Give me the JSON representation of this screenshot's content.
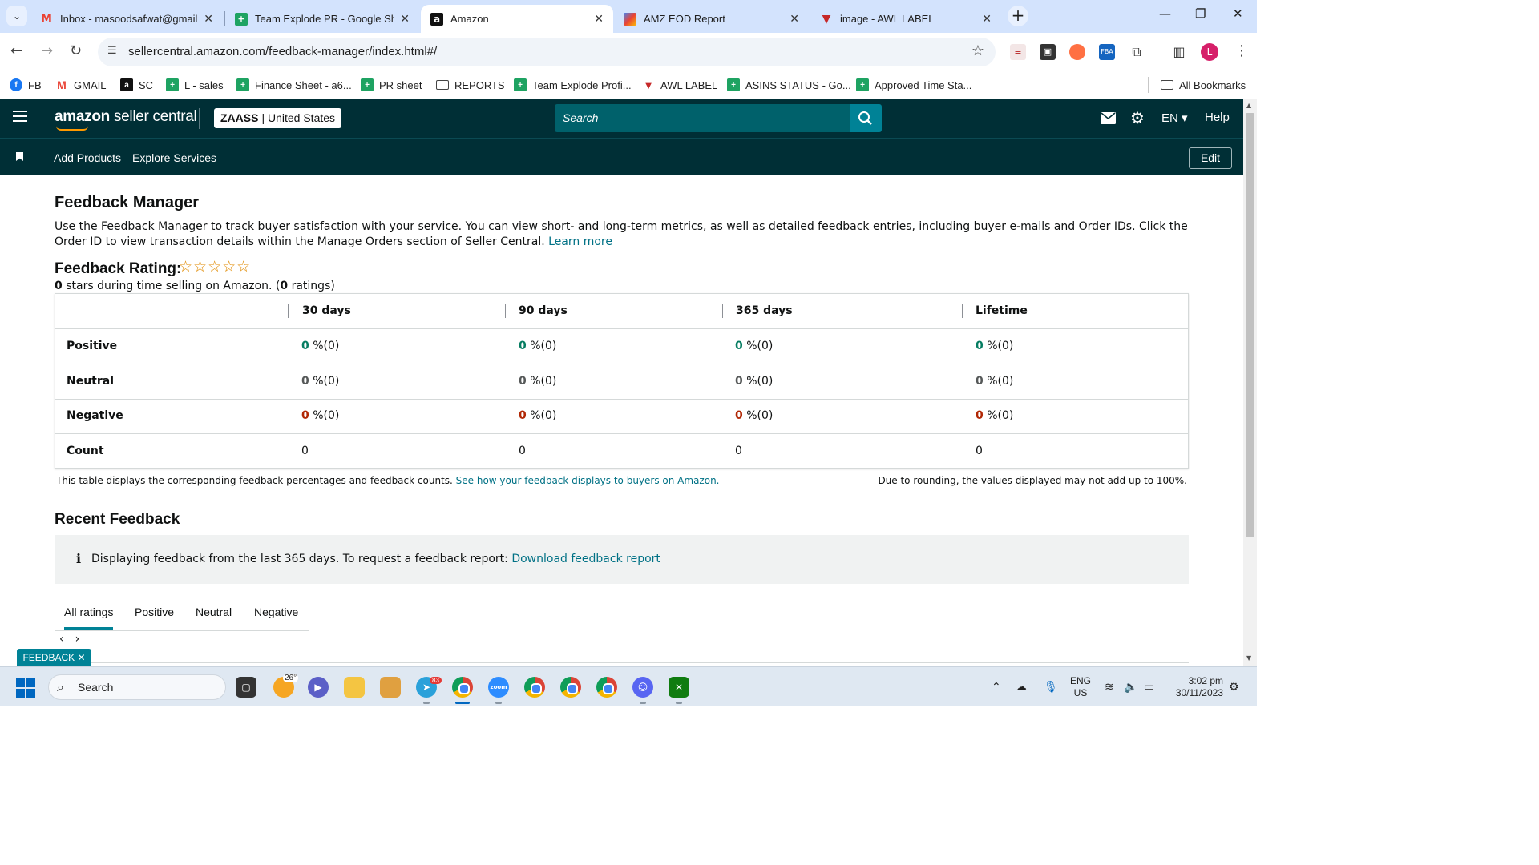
{
  "browser": {
    "tabs": [
      {
        "title": "Inbox - masoodsafwat@gmail.",
        "icon": "gmail-icon",
        "active": false
      },
      {
        "title": "Team Explode PR - Google She",
        "icon": "sheets-icon",
        "active": false
      },
      {
        "title": "Amazon",
        "icon": "amazon-icon",
        "active": true
      },
      {
        "title": "AMZ EOD Report",
        "icon": "report-icon",
        "active": false
      },
      {
        "title": "image - AWL LABEL",
        "icon": "awl-icon",
        "active": false
      }
    ],
    "url": "sellercentral.amazon.com/feedback-manager/index.html#/",
    "profile_initial": "L",
    "bookmarks": [
      {
        "label": "FB",
        "icon": "facebook-icon"
      },
      {
        "label": "GMAIL",
        "icon": "gmail-icon"
      },
      {
        "label": "SC",
        "icon": "amazon-icon"
      },
      {
        "label": "L - sales",
        "icon": "sheets-icon"
      },
      {
        "label": "Finance Sheet - a6...",
        "icon": "sheets-icon"
      },
      {
        "label": "PR sheet",
        "icon": "sheets-icon"
      },
      {
        "label": "REPORTS",
        "icon": "folder-icon"
      },
      {
        "label": "Team Explode Profi...",
        "icon": "sheets-icon"
      },
      {
        "label": "AWL LABEL",
        "icon": "awl-icon"
      },
      {
        "label": "ASINS STATUS - Go...",
        "icon": "sheets-icon"
      },
      {
        "label": "Approved Time Sta...",
        "icon": "sheets-icon"
      }
    ],
    "all_bookmarks": "All Bookmarks"
  },
  "header": {
    "logo_bold": "amazon",
    "logo_rest": " seller central",
    "account_name": "ZAASS",
    "account_region": "| United States",
    "search_placeholder": "Search",
    "language": "EN",
    "help": "Help"
  },
  "subnav": {
    "links": [
      "Add Products",
      "Explore Services"
    ],
    "edit": "Edit"
  },
  "page": {
    "title": "Feedback Manager",
    "description": "Use the Feedback Manager to track buyer satisfaction with your service. You can view short- and long-term metrics, as well as detailed feedback entries, including buyer e-mails and Order IDs. Click the Order ID to view transaction details within the Manage Orders section of Seller Central.",
    "learn_more": "Learn more",
    "rating_title": "Feedback Rating:",
    "stars_display": "☆☆☆☆☆",
    "rating_value": "0",
    "rating_sub_mid": " stars during time selling on Amazon. (",
    "rating_count": "0",
    "rating_sub_end": " ratings)",
    "table": {
      "columns": [
        "30 days",
        "90 days",
        "365 days",
        "Lifetime"
      ],
      "rows": [
        {
          "label": "Positive",
          "values": [
            "0",
            "0",
            "0",
            "0"
          ],
          "suffix": " %(0)"
        },
        {
          "label": "Neutral",
          "values": [
            "0",
            "0",
            "0",
            "0"
          ],
          "suffix": " %(0)"
        },
        {
          "label": "Negative",
          "values": [
            "0",
            "0",
            "0",
            "0"
          ],
          "suffix": " %(0)"
        },
        {
          "label": "Count",
          "values": [
            "0",
            "0",
            "0",
            "0"
          ]
        }
      ]
    },
    "table_note": "This table displays the corresponding feedback percentages and feedback counts.",
    "table_note_link": "See how your feedback displays to buyers on Amazon.",
    "rounding_note": "Due to rounding, the values displayed may not add up to 100%.",
    "recent_title": "Recent Feedback",
    "info_text": "Displaying feedback from the last 365 days. To request a feedback report:",
    "info_link": "Download feedback report",
    "tabs": [
      "All ratings",
      "Positive",
      "Neutral",
      "Negative"
    ],
    "feedback_pill": "FEEDBACK ✕"
  },
  "taskbar": {
    "search": "Search",
    "weather_temp": "26°",
    "telegram_badge": "83",
    "language": "ENG",
    "region": "US",
    "time": "3:02 pm",
    "date": "30/11/2023"
  }
}
